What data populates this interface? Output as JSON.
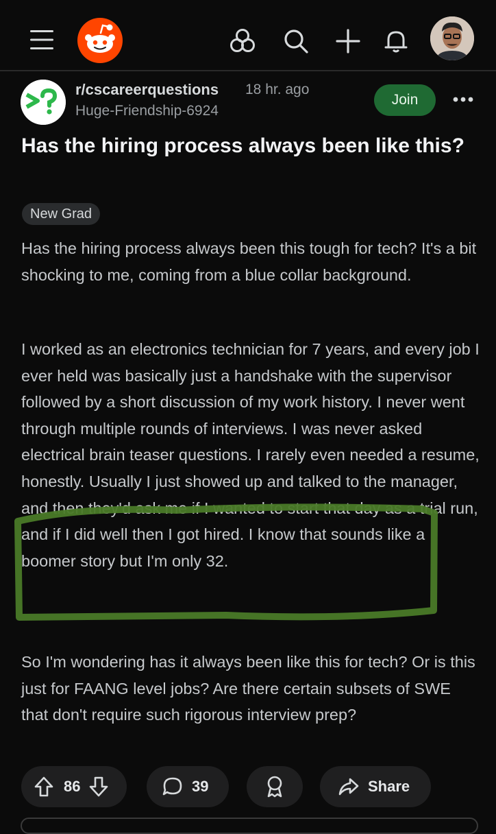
{
  "header": {
    "menu_icon": "hamburger-menu-icon",
    "logo": "reddit-snoo-logo",
    "icons": [
      "communities-icon",
      "search-icon",
      "create-plus-icon",
      "notifications-bell-icon"
    ],
    "avatar": "user-avatar"
  },
  "post": {
    "subreddit": "r/cscareerquestions",
    "time": "18 hr. ago",
    "author": "Huge-Friendship-6924",
    "join_label": "Join",
    "title": "Has the hiring process always been like this?",
    "flair": "New Grad",
    "body": {
      "p1": "Has the hiring process always been this tough for tech? It's a bit shocking to me, coming from a blue collar background.",
      "p2": "I worked as an electronics technician for 7 years, and every job I ever held was basically just a handshake with the supervisor followed by a short discussion of my work history. I never went through multiple rounds of interviews. I was never asked electrical brain teaser questions. I rarely even needed a resume, honestly. Usually I just showed up and talked to the manager, and then they'd ask me if I wanted to start that day as a trial run, and if I did well then I got hired. I know that sounds like a boomer story but I'm only 32.",
      "p3": "So I'm wondering has it always been like this for tech? Or is this just for FAANG level jobs? Are there certain subsets of SWE that don't require such rigorous interview prep?"
    },
    "highlight_color": "#4a7a28"
  },
  "actions": {
    "votes": "86",
    "comments": "39",
    "share_label": "Share"
  }
}
